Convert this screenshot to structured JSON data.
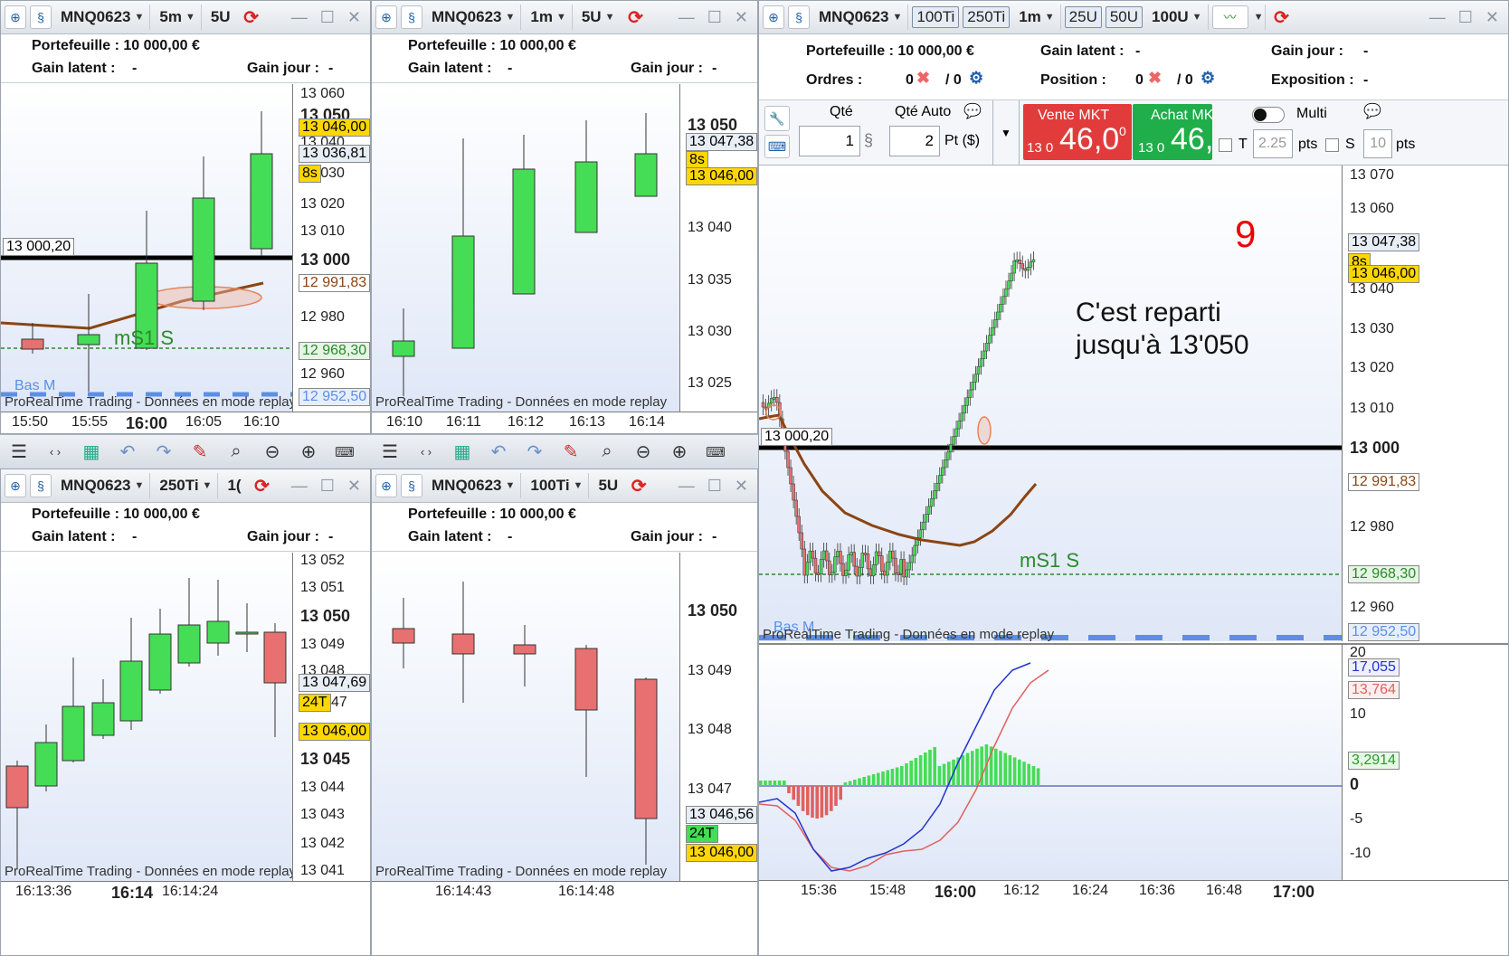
{
  "portfolio_label": "Portefeuille : 10 000,00 €",
  "latent_label": "Gain latent :",
  "latent_value": "-",
  "day_label": "Gain jour :",
  "day_value": "-",
  "instrument": "MNQ0623",
  "watermark": "ProRealTime Trading - Données en mode replay",
  "w1": {
    "timeframe": "5m",
    "units": "5U",
    "yticks": [
      "13 060",
      "13 050",
      "13 040",
      "13 030",
      "13 020",
      "13 010",
      "13 000",
      "12 980",
      "12 960"
    ],
    "tags": [
      "13 046,00",
      "13 036,81",
      "8s",
      "12 991,83",
      "12 968,30",
      "12 952,50"
    ],
    "xticks": [
      "15:50",
      "15:55",
      "16:00",
      "16:05",
      "16:10"
    ],
    "line_label": "13 000,20",
    "ms1": "mS1 S",
    "basm": "Bas M"
  },
  "w2": {
    "timeframe": "1m",
    "units": "5U",
    "yticks": [
      "13 050",
      "13 040",
      "13 035",
      "13 030",
      "13 025"
    ],
    "tags": [
      "13 047,38",
      "8s",
      "13 046,00"
    ],
    "xticks": [
      "16:10",
      "16:11",
      "16:12",
      "16:13",
      "16:14"
    ]
  },
  "w3": {
    "timeframe": "250Ti",
    "units": "1(",
    "yticks": [
      "13 052",
      "13 051",
      "13 050",
      "13 049",
      "13 048",
      "13 045",
      "13 044",
      "13 043",
      "13 042",
      "13 041"
    ],
    "tags": [
      "13 047,69",
      "24T",
      "47",
      "13 046,00"
    ],
    "xticks": [
      "16:13:36",
      "16:14",
      "16:14:24"
    ]
  },
  "w4": {
    "timeframe": "100Ti",
    "units": "5U",
    "yticks": [
      "13 050",
      "13 049",
      "13 048",
      "13 047"
    ],
    "tags": [
      "13 046,56",
      "24T",
      "13 046,00"
    ],
    "xticks": [
      "16:14:43",
      "16:14:48"
    ]
  },
  "w5": {
    "btn_100": "100Ti",
    "btn_250": "250Ti",
    "timeframe": "1m",
    "btn_25u": "25U",
    "btn_50u": "50U",
    "btn_100u": "100U",
    "orders_label": "Ordres :",
    "orders_val": "0",
    "orders_auto": "/ 0",
    "position_label": "Position :",
    "position_val": "0",
    "position_auto": "/ 0",
    "exposition_label": "Exposition :",
    "exposition_value": "-",
    "qte_label": "Qté",
    "qte_auto_label": "Qté Auto",
    "qte_value": "1",
    "qte_auto_value": "2",
    "pt_unit": "Pt ($)",
    "sell_label": "Vente MKT",
    "sell_small": "13 0",
    "sell_big": "46,0",
    "sell_sup": "0",
    "buy_label": "Achat MK",
    "buy_small": "13 0",
    "buy_big": "46,",
    "multi_label": "Multi",
    "t_label": "T",
    "t_value": "2.25",
    "pts": "pts",
    "s_label": "S",
    "s_value": "10",
    "counter": "9",
    "annotation_line1": "C'est reparti",
    "annotation_line2": "jusqu'à 13'050",
    "yticks": [
      "13 070",
      "13 060",
      "13 040",
      "13 030",
      "13 020",
      "13 010",
      "13 000",
      "12 980",
      "12 960"
    ],
    "tags": [
      "13 047,38",
      "8s",
      "13 046,00",
      "12 991,83",
      "12 968,30",
      "12 952,50"
    ],
    "ind_ticks": [
      "20",
      "10",
      "0",
      "-5",
      "-10"
    ],
    "ind_tags": [
      "17,055",
      "13,764",
      "3,2914"
    ],
    "xticks": [
      "15:36",
      "15:48",
      "16:00",
      "16:12",
      "16:24",
      "16:36",
      "16:48",
      "17:00"
    ],
    "line_label": "13 000,20",
    "ms1": "mS1 S",
    "basm": "Bas M"
  },
  "colors": {
    "bull": "#44dd55",
    "bear": "#e87070",
    "yellow": "#ffd700",
    "ma": "#8b4513"
  }
}
